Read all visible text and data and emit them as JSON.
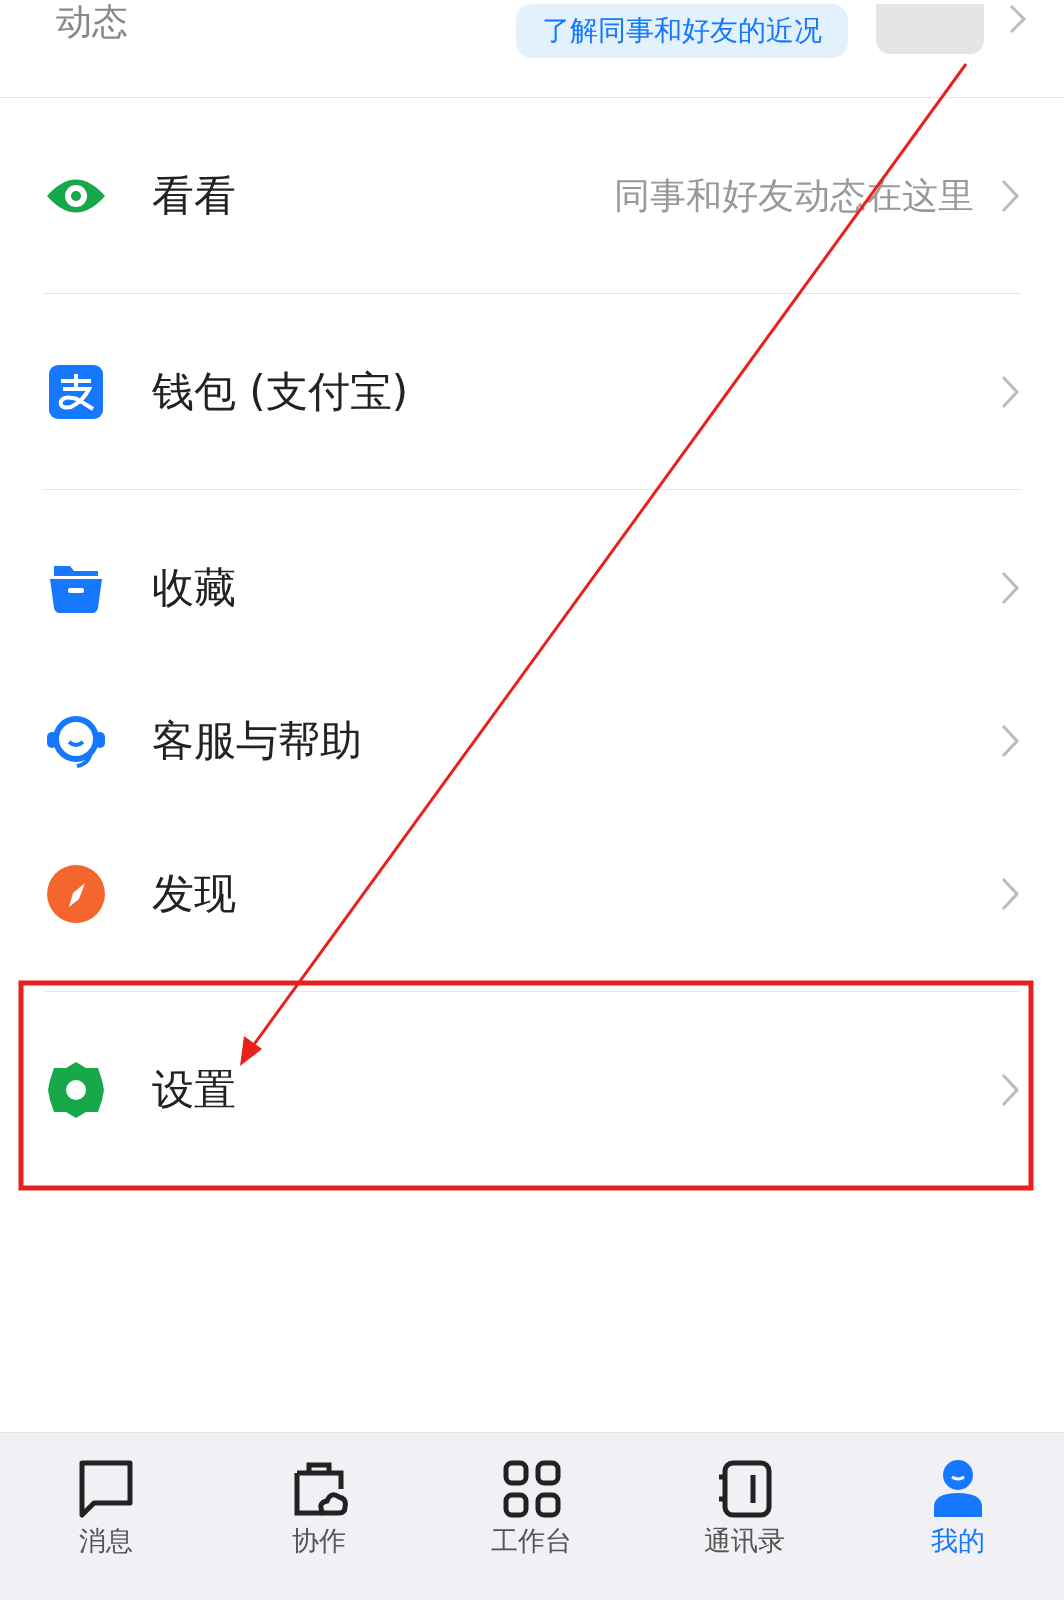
{
  "top_row": {
    "label": "动态",
    "bubble": "了解同事和好友的近况"
  },
  "sections": [
    {
      "items": [
        {
          "label": "看看",
          "hint": "同事和好友动态在这里"
        }
      ]
    },
    {
      "items": [
        {
          "label": "钱包 (支付宝)"
        }
      ]
    },
    {
      "items": [
        {
          "label": "收藏"
        },
        {
          "label": "客服与帮助"
        },
        {
          "label": "发现"
        }
      ]
    },
    {
      "items": [
        {
          "label": "设置"
        }
      ]
    }
  ],
  "tab_bar": [
    {
      "label": "消息",
      "selected": false
    },
    {
      "label": "协作",
      "selected": false
    },
    {
      "label": "工作台",
      "selected": false
    },
    {
      "label": "通讯录",
      "selected": false
    },
    {
      "label": "我的",
      "selected": true
    }
  ]
}
